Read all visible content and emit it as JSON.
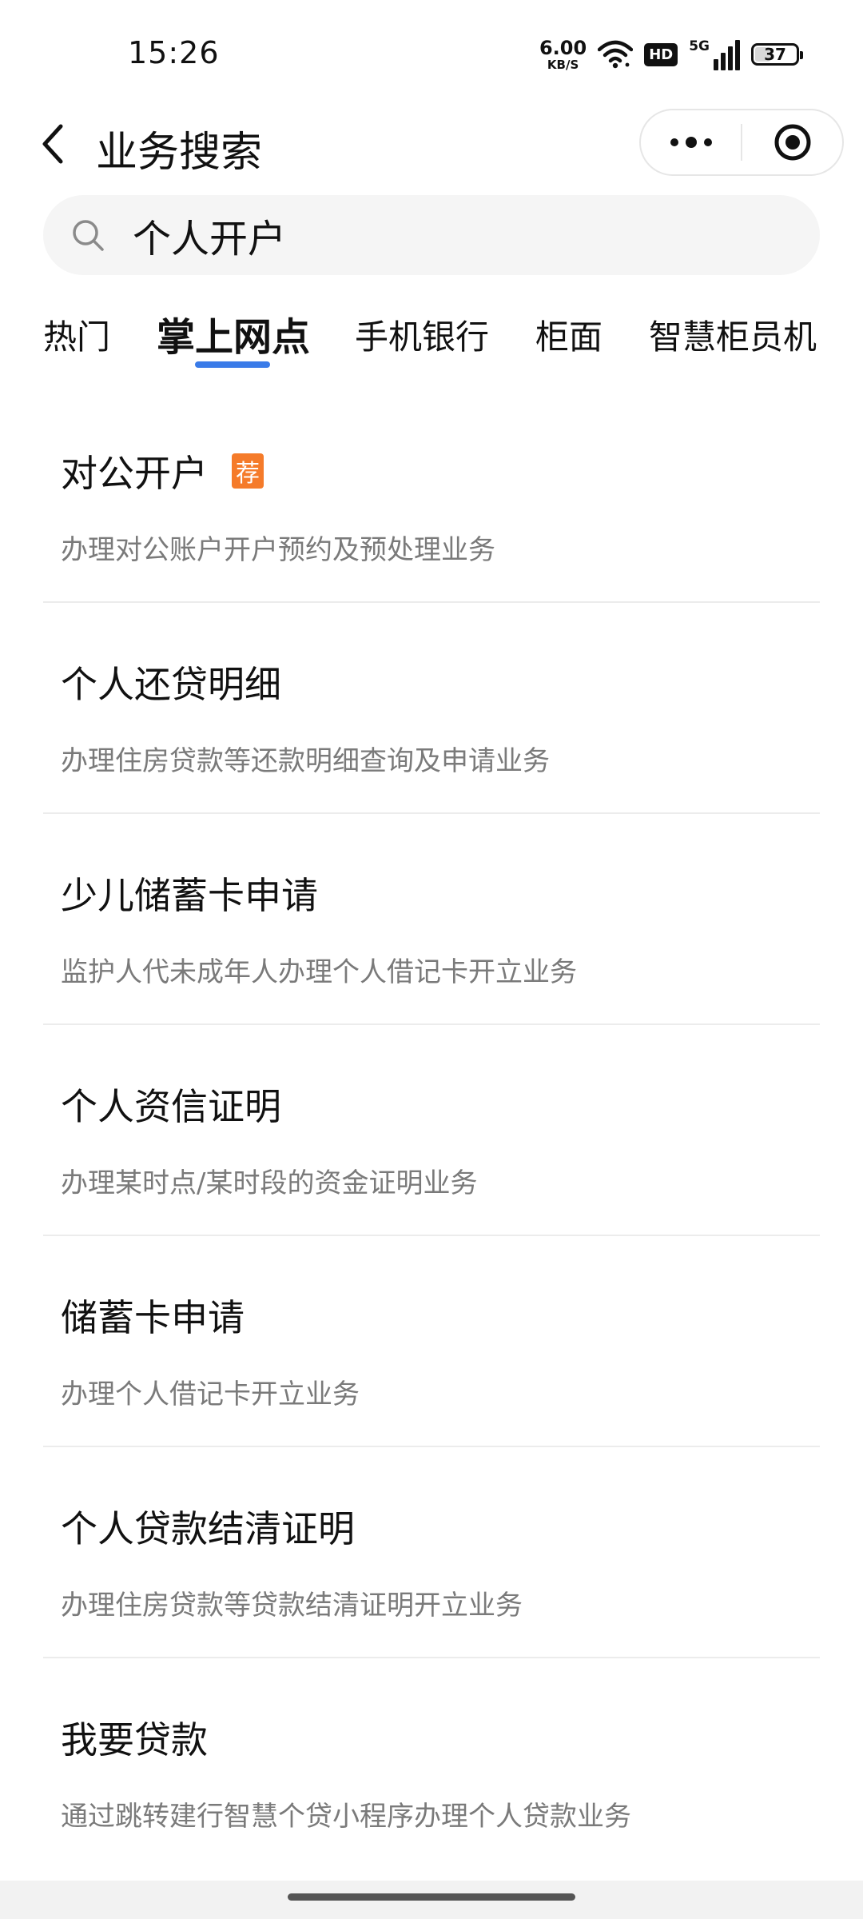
{
  "status_bar": {
    "time": "15:26",
    "net_speed_value": "6.00",
    "net_speed_unit": "KB/S",
    "hd_label": "HD",
    "network_label": "5G",
    "battery_level": "37"
  },
  "header": {
    "title": "业务搜索"
  },
  "search": {
    "value": "个人开户"
  },
  "tabs": [
    {
      "label": "热门",
      "active": false
    },
    {
      "label": "掌上网点",
      "active": true
    },
    {
      "label": "手机银行",
      "active": false
    },
    {
      "label": "柜面",
      "active": false
    },
    {
      "label": "智慧柜员机",
      "active": false
    }
  ],
  "items": [
    {
      "title": "对公开户",
      "badge": "荐",
      "desc": "办理对公账户开户预约及预处理业务"
    },
    {
      "title": "个人还贷明细",
      "desc": "办理住房贷款等还款明细查询及申请业务"
    },
    {
      "title": "少儿储蓄卡申请",
      "desc": "监护人代未成年人办理个人借记卡开立业务"
    },
    {
      "title": "个人资信证明",
      "desc": "办理某时点/某时段的资金证明业务"
    },
    {
      "title": "储蓄卡申请",
      "desc": "办理个人借记卡开立业务"
    },
    {
      "title": "个人贷款结清证明",
      "desc": "办理住房贷款等贷款结清证明开立业务"
    },
    {
      "title": "我要贷款",
      "desc": "通过跳转建行智慧个贷小程序办理个人贷款业务"
    }
  ],
  "colors": {
    "accent": "#3a7be8",
    "badge": "#f57b2a",
    "desc_text": "#7a7a7a",
    "search_bg": "#f5f5f5"
  },
  "icons": {
    "back": "chevron-left-icon",
    "more": "more-dots-icon",
    "close": "target-circle-icon",
    "search": "search-icon",
    "wifi": "wifi-icon",
    "signal": "signal-bars-icon",
    "battery": "battery-icon"
  }
}
